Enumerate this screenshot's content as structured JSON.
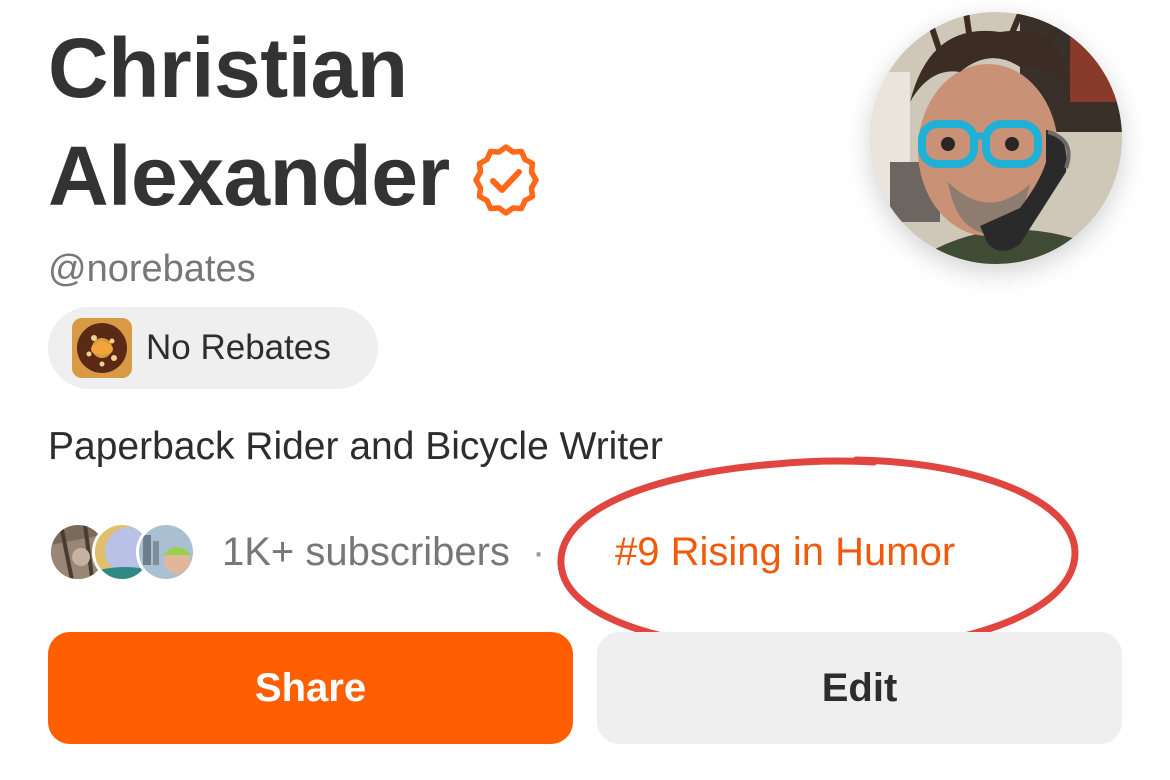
{
  "profile": {
    "name_line1": "Christian",
    "name_line2": "Alexander",
    "handle": "@norebates",
    "bio": "Paperback Rider and Bicycle Writer",
    "verified_icon": "verified-badge-icon",
    "avatar": "profile-photo"
  },
  "publication": {
    "name": "No Rebates",
    "logo": "publication-logo"
  },
  "stats": {
    "subscribers": "1K+ subscribers",
    "separator": "·",
    "rank": "#9 Rising in Humor"
  },
  "actions": {
    "share_label": "Share",
    "edit_label": "Edit"
  },
  "colors": {
    "accent": "#ff5f00",
    "rank_text": "#f05a0a",
    "annotation": "#e0453f",
    "chip_bg": "#efefef",
    "muted_text": "#777777"
  }
}
